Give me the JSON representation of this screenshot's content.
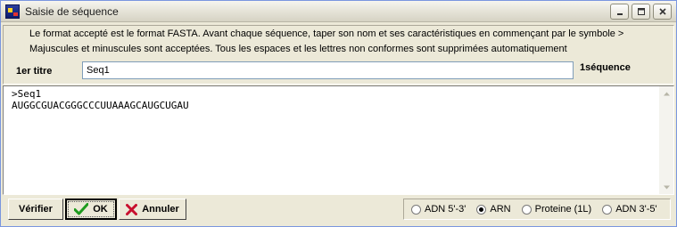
{
  "window": {
    "title": "Saisie de séquence"
  },
  "info": {
    "line1": "Le format accepté est le format FASTA. Avant chaque séquence, taper son nom et ses caractéristiques en commençant par le symbole >",
    "line2": "Majuscules et minuscules sont acceptées. Tous les espaces et les lettres non conformes sont supprimées automatiquement",
    "first_title_label": "1er titre",
    "first_title_value": "Seq1",
    "sequence_count": "1séquence"
  },
  "sequence": {
    "line1": ">Seq1",
    "line2": "AUGGCGUACGGGCCCUUAAAGCAUGCUGAU"
  },
  "buttons": {
    "verify": "Vérifier",
    "ok": "OK",
    "cancel": "Annuler"
  },
  "radio_options": {
    "adn53": "ADN 5'-3'",
    "arn": "ARN",
    "proteine": "Proteine (1L)",
    "adn35": "ADN 3'-5'",
    "selected": "ARN"
  },
  "icons": {
    "ok": "checkmark-icon",
    "cancel": "x-icon",
    "app": "app-icon",
    "minimize": "minimize-icon",
    "maximize": "maximize-icon",
    "close": "close-icon"
  },
  "colors": {
    "window_bg": "#ece9d8",
    "check_green": "#1e9b1e",
    "cancel_red": "#c8102e"
  }
}
